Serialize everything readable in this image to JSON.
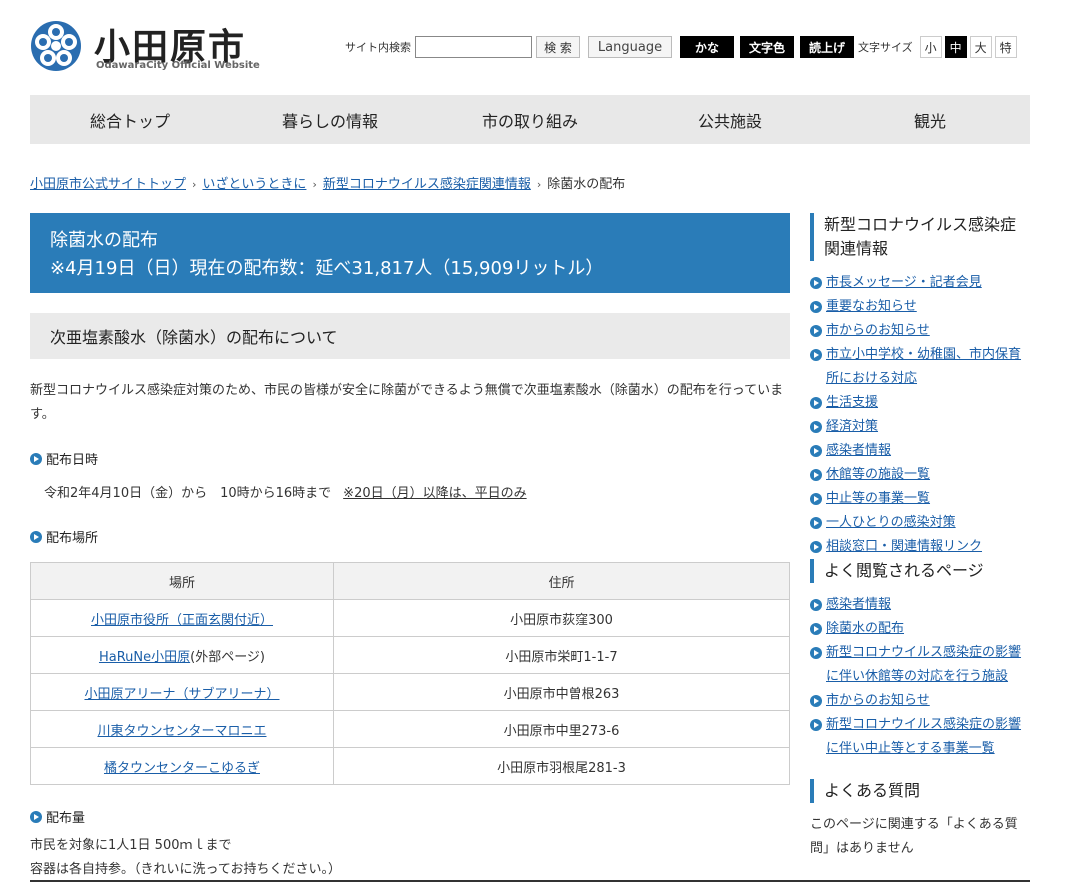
{
  "header": {
    "logo_title": "小田原市",
    "logo_sub": "OdawaraCity Official Website",
    "search_label": "サイト内検索",
    "search_placeholder": "",
    "search_button": "検 索",
    "language_button": "Language",
    "kana_button": "かな",
    "color_button": "文字色",
    "read_button": "読上げ",
    "font_size_label": "文字サイズ",
    "font_sizes": [
      "小",
      "中",
      "大",
      "特"
    ]
  },
  "gnav": [
    "総合トップ",
    "暮らしの情報",
    "市の取り組み",
    "公共施設",
    "観光"
  ],
  "breadcrumb": {
    "items": [
      "小田原市公式サイトトップ",
      "いざというときに",
      "新型コロナウイルス感染症関連情報"
    ],
    "current": "除菌水の配布",
    "sep": "＞"
  },
  "main": {
    "title_line1": "除菌水の配布",
    "title_line2": "※4月19日（日）現在の配布数：延べ31,817人（15,909リットル）",
    "section_head": "次亜塩素酸水（除菌水）の配布について",
    "intro": "新型コロナウイルス感染症対策のため、市民の皆様が安全に除菌ができるよう無償で次亜塩素酸水（除菌水）の配布を行っています。",
    "date_head": "配布日時",
    "date_text": "令和2年4月10日（金）から　10時から16時まで",
    "date_note": "※20日（月）以降は、平日のみ",
    "place_head": "配布場所",
    "table": {
      "headers": [
        "場所",
        "住所"
      ],
      "rows": [
        {
          "place": "小田原市役所（正面玄関付近）",
          "suffix": "",
          "address": "小田原市荻窪300"
        },
        {
          "place": "HaRuNe小田原",
          "suffix": "(外部ページ)",
          "address": "小田原市栄町1-1-7"
        },
        {
          "place": "小田原アリーナ（サブアリーナ）",
          "suffix": "",
          "address": "小田原市中曽根263"
        },
        {
          "place": "川東タウンセンターマロニエ",
          "suffix": "",
          "address": "小田原市中里273-6"
        },
        {
          "place": "橘タウンセンターこゆるぎ",
          "suffix": "",
          "address": "小田原市羽根尾281-3"
        }
      ]
    },
    "amount_head": "配布量",
    "amount_line1": "市民を対象に1人1日 500ｍｌまで",
    "amount_line2": "容器は各自持参。（きれいに洗ってお持ちください。）"
  },
  "side": {
    "head1": "新型コロナウイルス感染症関連情報",
    "list1": [
      "市長メッセージ・記者会見",
      "重要なお知らせ",
      "市からのお知らせ",
      "市立小中学校・幼稚園、市内保育所における対応",
      "生活支援",
      "経済対策",
      "感染者情報",
      "休館等の施設一覧",
      "中止等の事業一覧",
      "一人ひとりの感染対策",
      "相談窓口・関連情報リンク"
    ],
    "head2": "よく閲覧されるページ",
    "list2": [
      "感染者情報",
      "除菌水の配布",
      "新型コロナウイルス感染症の影響に伴い休館等の対応を行う施設",
      "市からのお知らせ",
      "新型コロナウイルス感染症の影響に伴い中止等とする事業一覧"
    ],
    "head3": "よくある質問",
    "faq_note": "このページに関連する「よくある質問」はありません"
  },
  "colors": {
    "accent": "#2a7cb8",
    "nav_bg": "#e8e8e8"
  }
}
